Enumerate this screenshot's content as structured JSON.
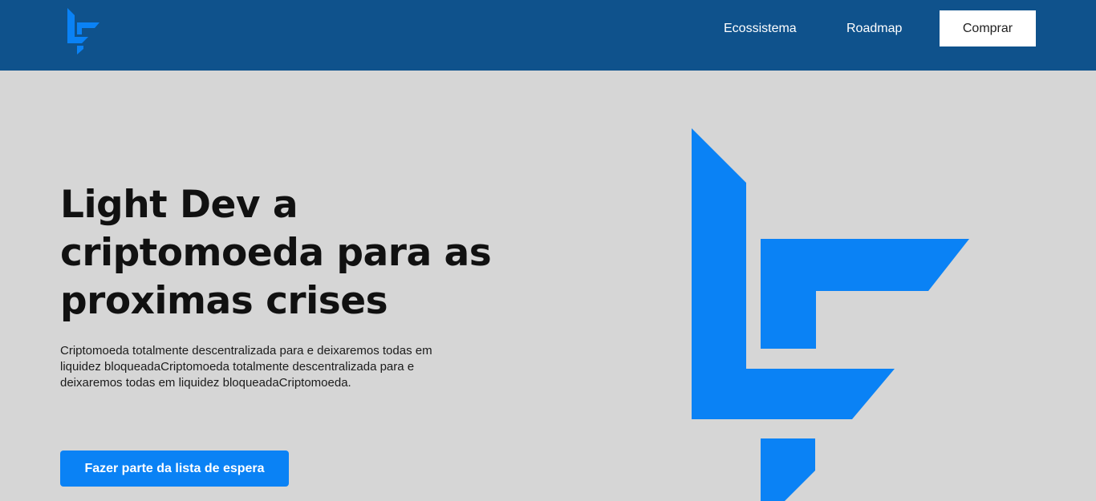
{
  "brand": {
    "logo_icon": "lightdev-logo-icon",
    "accent_color": "#0a82f5",
    "header_color": "#0f528c"
  },
  "nav": {
    "items": [
      {
        "label": "Ecossistema"
      },
      {
        "label": "Roadmap"
      }
    ],
    "buy_label": "Comprar"
  },
  "hero": {
    "title": "Light Dev a criptomoeda para as proximas crises",
    "description": "Criptomoeda totalmente descentralizada para e deixaremos todas em liquidez bloqueadaCriptomoeda totalmente descentralizada para e deixaremos todas em liquidez bloqueadaCriptomoeda.",
    "cta_label": "Fazer parte da lista de espera"
  }
}
